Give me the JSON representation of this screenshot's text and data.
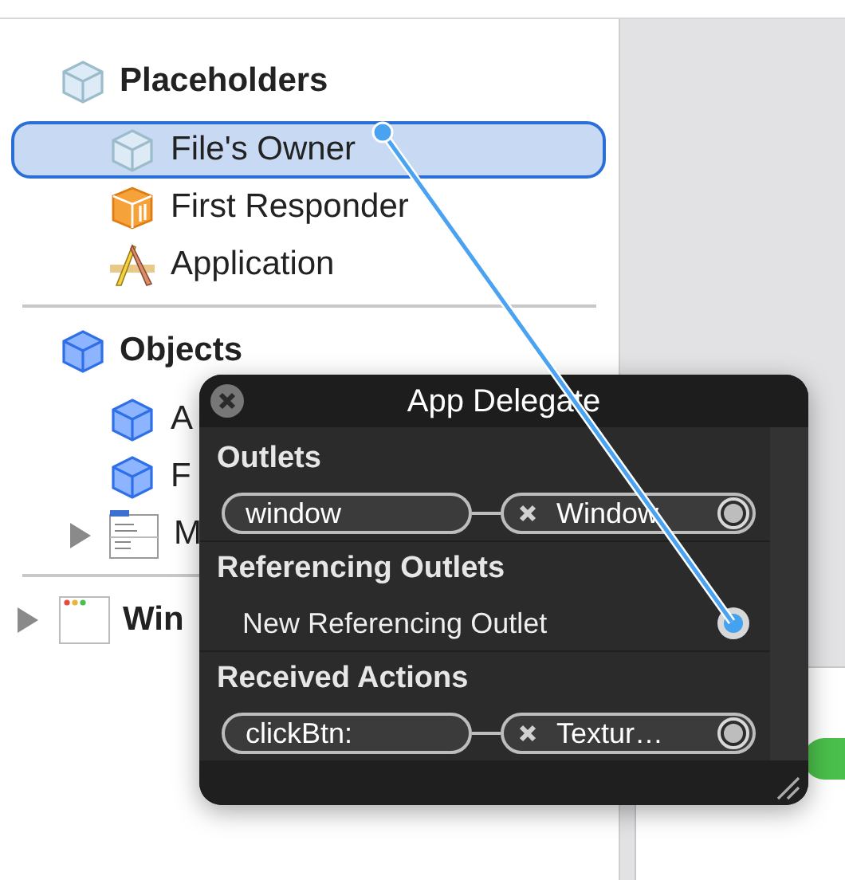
{
  "outline": {
    "groups": [
      {
        "title": "Placeholders",
        "kind": "placeholder",
        "items": [
          {
            "label": "File's Owner",
            "kind": "placeholder",
            "selected": true
          },
          {
            "label": "First Responder",
            "kind": "responder",
            "selected": false
          },
          {
            "label": "Application",
            "kind": "application",
            "selected": false
          }
        ]
      },
      {
        "title": "Objects",
        "kind": "object",
        "items": [
          {
            "label": "A",
            "kind": "object",
            "selected": false
          },
          {
            "label": "F",
            "kind": "object",
            "selected": false
          },
          {
            "label": "M",
            "kind": "menu",
            "selected": false,
            "expanded": false
          }
        ]
      },
      {
        "title": "Win",
        "kind": "window",
        "expanded": false
      }
    ]
  },
  "connections_panel": {
    "title": "App Delegate",
    "sections": [
      {
        "heading": "Outlets",
        "rows": [
          {
            "kind": "connection",
            "name": "window",
            "target": "Window"
          }
        ]
      },
      {
        "heading": "Referencing Outlets",
        "rows": [
          {
            "kind": "new",
            "name": "New Referencing Outlet"
          }
        ]
      },
      {
        "heading": "Received Actions",
        "rows": [
          {
            "kind": "connection",
            "name": "clickBtn:",
            "target": "Textur…"
          }
        ]
      }
    ]
  }
}
